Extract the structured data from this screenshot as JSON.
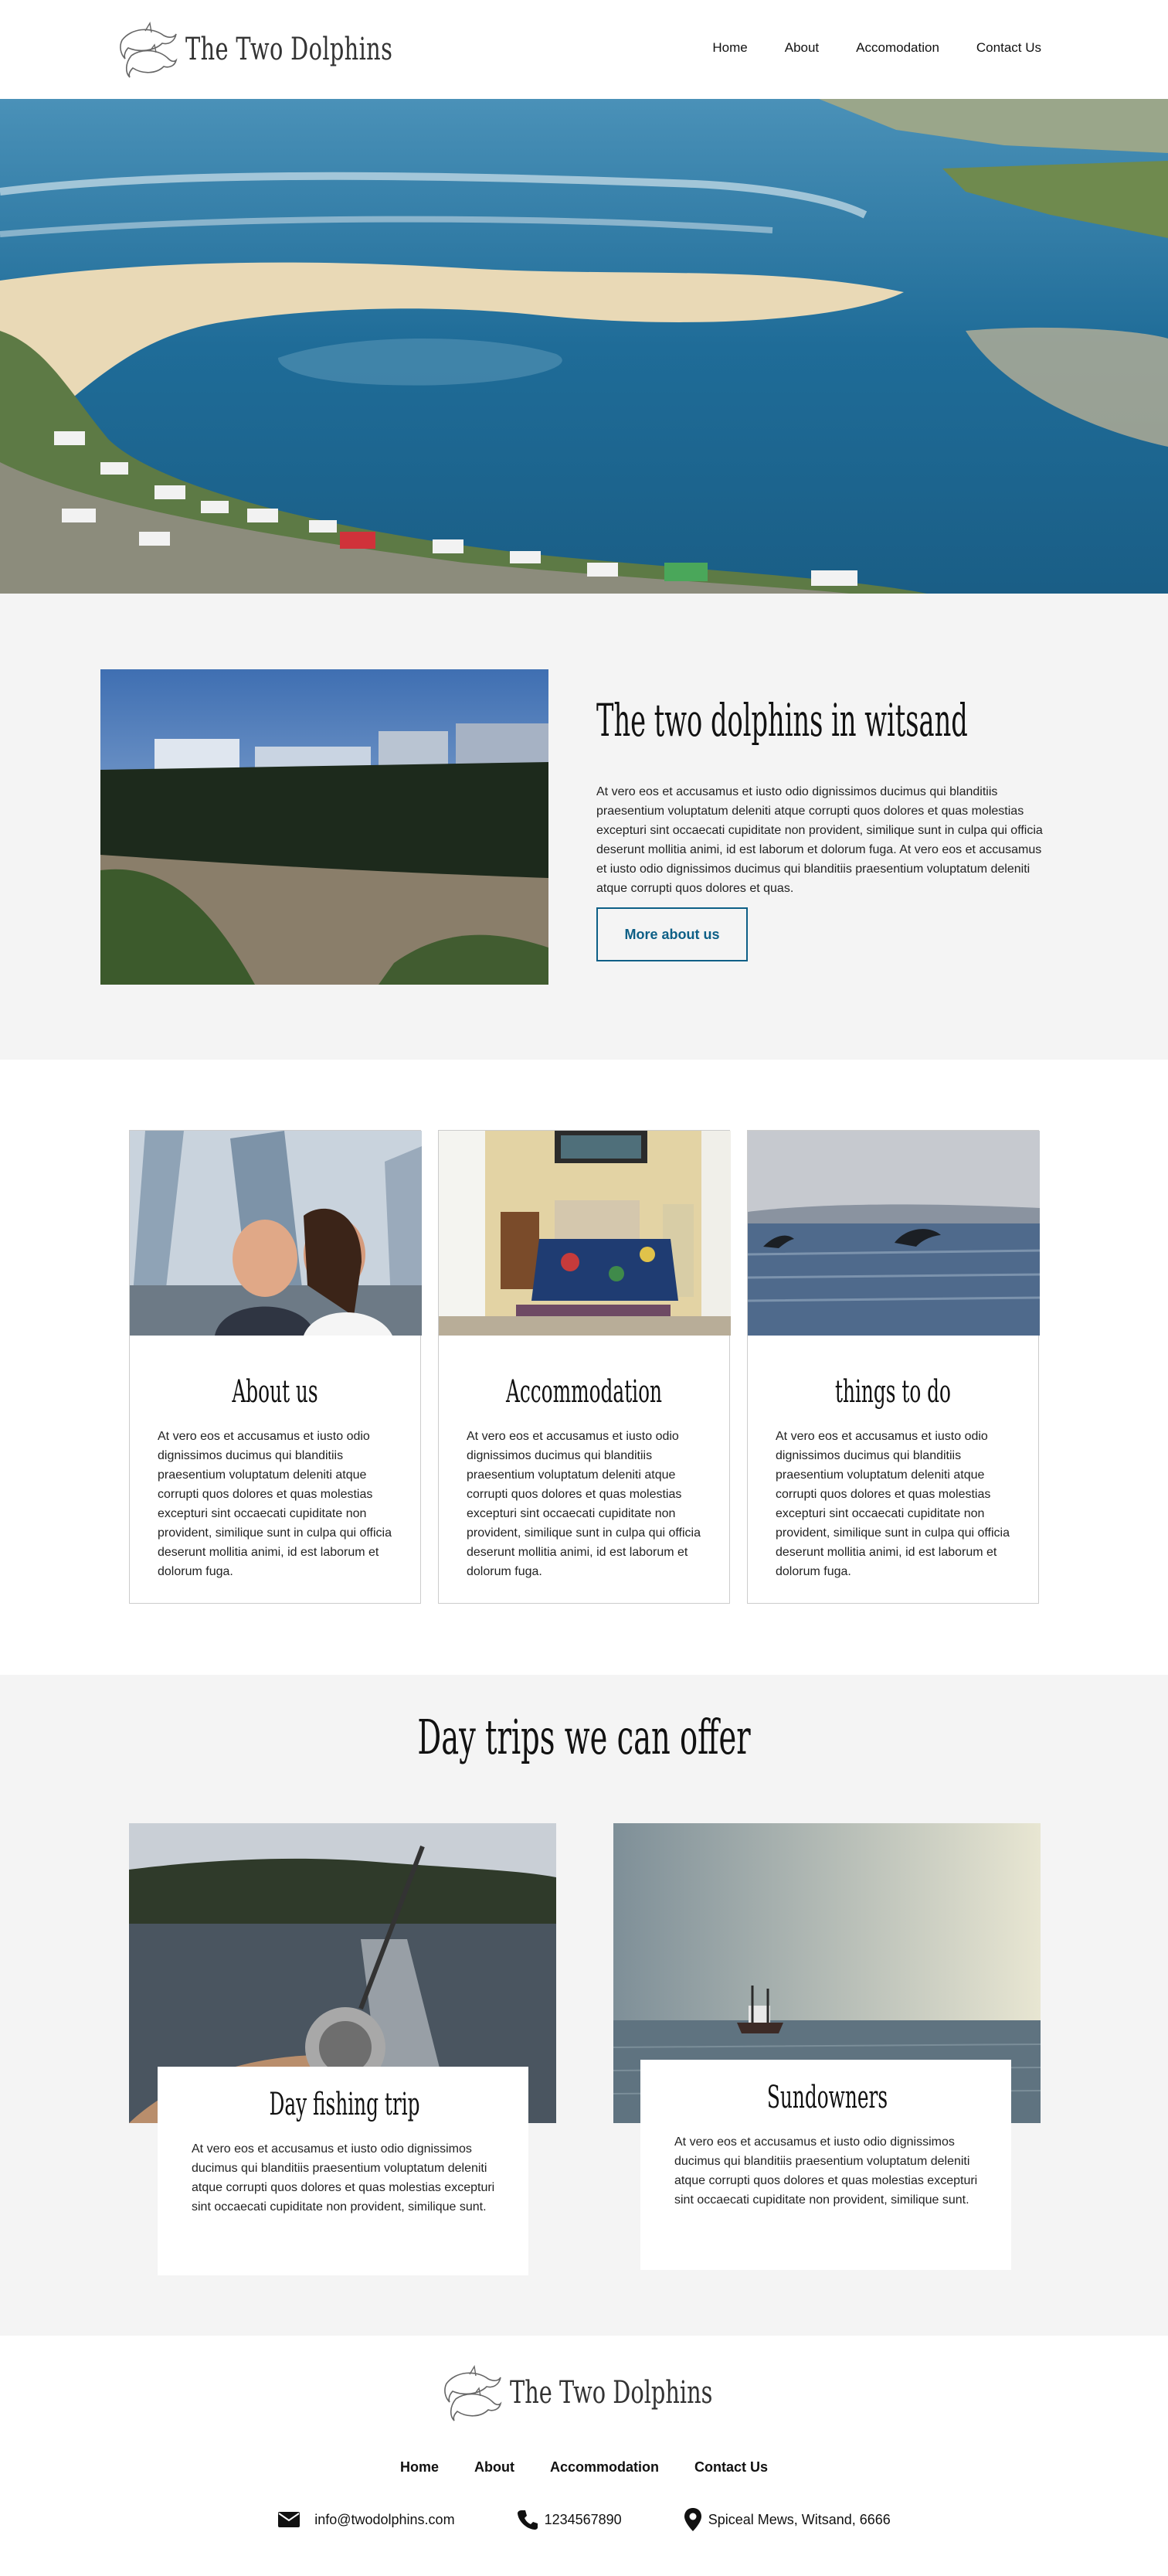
{
  "header": {
    "logo_text": "The Two Dolphins",
    "nav": [
      "Home",
      "About",
      "Accomodation",
      "Contact Us"
    ]
  },
  "about": {
    "title": "The two dolphins in witsand",
    "text": "At vero eos et accusamus et iusto odio dignissimos ducimus qui blanditiis praesentium voluptatum deleniti atque corrupti quos dolores et quas molestias excepturi sint occaecati cupiditate non provident, similique sunt in culpa qui officia deserunt mollitia animi, id est laborum et dolorum fuga. At vero eos et accusamus et iusto odio dignissimos ducimus qui blanditiis praesentium voluptatum deleniti atque corrupti quos dolores et quas.",
    "button": "More about us"
  },
  "cards": [
    {
      "title": "About us",
      "text": "At vero eos et accusamus et iusto odio dignissimos ducimus qui blanditiis praesentium voluptatum deleniti atque corrupti quos dolores et quas molestias excepturi sint occaecati cupiditate non provident, similique sunt in culpa qui officia deserunt mollitia animi, id est laborum et dolorum fuga."
    },
    {
      "title": "Accommodation",
      "text": "At vero eos et accusamus et iusto odio dignissimos ducimus qui blanditiis praesentium voluptatum deleniti atque corrupti quos dolores et quas molestias excepturi sint occaecati cupiditate non provident, similique sunt in culpa qui officia deserunt mollitia animi, id est laborum et dolorum fuga."
    },
    {
      "title": "things to do",
      "text": "At vero eos et accusamus et iusto odio dignissimos ducimus qui blanditiis praesentium voluptatum deleniti atque corrupti quos dolores et quas molestias excepturi sint occaecati cupiditate non provident, similique sunt in culpa qui officia deserunt mollitia animi, id est laborum et dolorum fuga."
    }
  ],
  "trips": {
    "title": "Day trips we can offer",
    "items": [
      {
        "title": "Day fishing trip",
        "text": "At vero eos et accusamus et iusto odio dignissimos ducimus qui blanditiis praesentium voluptatum deleniti atque corrupti quos dolores et quas molestias excepturi sint occaecati cupiditate non provident, similique sunt."
      },
      {
        "title": "Sundowners",
        "text": "At vero eos et accusamus et iusto odio dignissimos ducimus qui blanditiis praesentium voluptatum deleniti atque corrupti quos dolores et quas molestias excepturi sint occaecati cupiditate non provident, similique sunt."
      }
    ]
  },
  "footer": {
    "logo_text": "The Two Dolphins",
    "nav": [
      "Home",
      "About",
      "Accommodation",
      "Contact Us"
    ],
    "email": "info@twodolphins.com",
    "phone": "1234567890",
    "address": "Spiceal Mews, Witsand, 6666",
    "icons": [
      "envelope-icon",
      "phone-icon",
      "location-pin-icon"
    ]
  },
  "colors": {
    "accent": "#0d5f86",
    "section_bg": "#f4f4f4"
  }
}
